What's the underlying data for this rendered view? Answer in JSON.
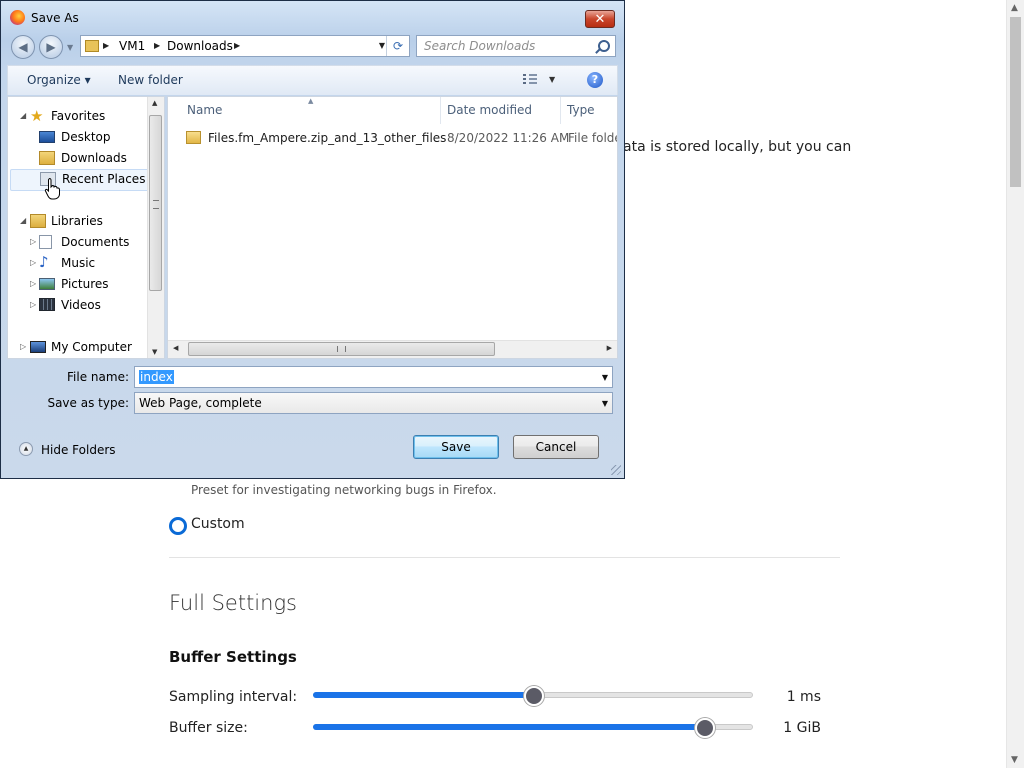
{
  "background": {
    "snippet": "ata is stored locally, but you can",
    "preset_desc": "Preset for investigating networking bugs in Firefox.",
    "custom_label": "Custom",
    "full_settings": "Full Settings",
    "buffer_settings": "Buffer Settings",
    "sampling_label": "Sampling interval:",
    "sampling_value": "1 ms",
    "sampling_level": 0.5,
    "buffer_label": "Buffer size:",
    "buffer_value": "1 GiB",
    "buffer_level": 0.89
  },
  "dialog": {
    "title": "Save As",
    "close_label": "✕",
    "address": [
      "VM1",
      "Downloads"
    ],
    "search_placeholder": "Search Downloads",
    "toolbar": {
      "organize": "Organize ▾",
      "new_folder": "New folder",
      "help": "?"
    },
    "nav": [
      {
        "label": "Favorites",
        "icon": "star-icon"
      },
      {
        "label": "Desktop",
        "icon": "desktop-icon"
      },
      {
        "label": "Downloads",
        "icon": "downloads-folder-icon"
      },
      {
        "label": "Recent Places",
        "icon": "recent-places-icon"
      },
      {
        "label": "Libraries",
        "icon": "libraries-icon"
      },
      {
        "label": "Documents",
        "icon": "documents-icon"
      },
      {
        "label": "Music",
        "icon": "music-icon"
      },
      {
        "label": "Pictures",
        "icon": "pictures-icon"
      },
      {
        "label": "Videos",
        "icon": "videos-icon"
      },
      {
        "label": "My Computer",
        "icon": "computer-icon"
      }
    ],
    "columns": {
      "name": "Name",
      "date": "Date modified",
      "type": "Type"
    },
    "files": [
      {
        "name": "Files.fm_Ampere.zip_and_13_other_files",
        "date": "8/20/2022 11:26 AM",
        "type": "File folder"
      }
    ],
    "file_name_label": "File name:",
    "file_name_value": "index",
    "save_type_label": "Save as type:",
    "save_type_value": "Web Page, complete",
    "hide_folders": "Hide Folders",
    "save_button": "Save",
    "cancel_button": "Cancel"
  },
  "colors": {
    "accent": "#1a73e8",
    "selection": "#3399ff",
    "dialog_frame": "#c5d9ef"
  }
}
